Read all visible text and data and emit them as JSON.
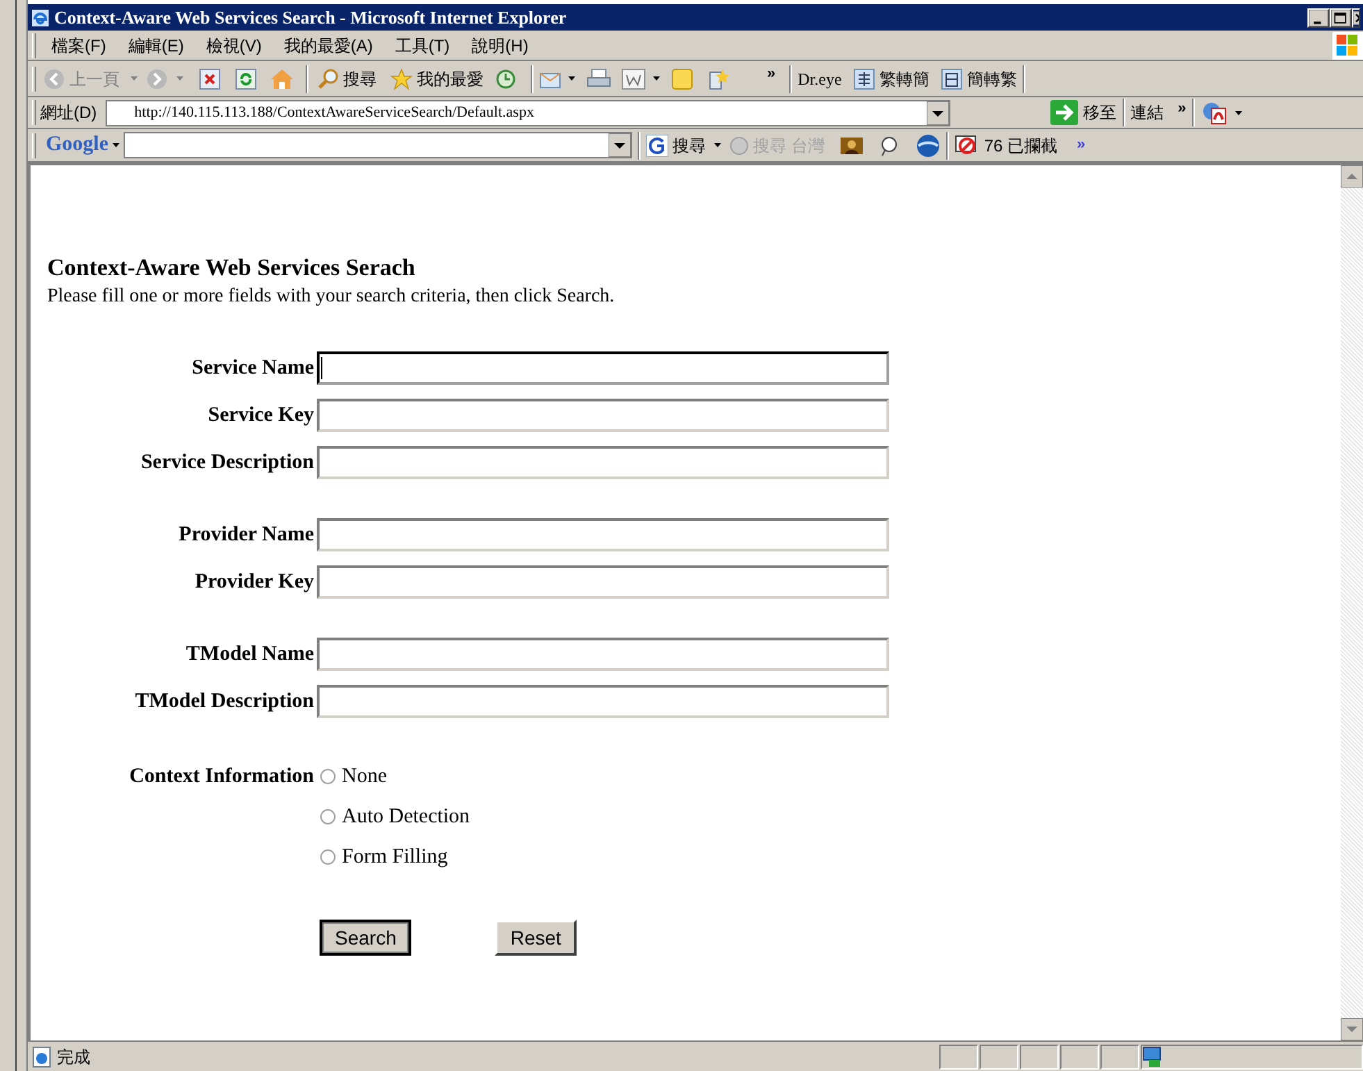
{
  "window": {
    "title": "Context-Aware Web Services Search - Microsoft Internet Explorer"
  },
  "menu": [
    "檔案(F)",
    "編輯(E)",
    "檢視(V)",
    "我的最愛(A)",
    "工具(T)",
    "說明(H)"
  ],
  "toolbar": {
    "back": "上一頁",
    "search": "搜尋",
    "favorites": "我的最愛",
    "more": "»",
    "dreye": "Dr.eye",
    "to_simplified": "繁轉簡",
    "to_traditional": "簡轉繁"
  },
  "address_bar": {
    "label": "網址(D)",
    "url": "http://140.115.113.188/ContextAwareServiceSearch/Default.aspx",
    "go": "移至",
    "links": "連結",
    "more": "»"
  },
  "google_bar": {
    "logo": "Google",
    "search": "搜尋",
    "search_taiwan": "搜尋 台灣",
    "blocked": "76 已攔截",
    "more": "»"
  },
  "page": {
    "heading": "Context-Aware Web Services Serach",
    "instructions": "Please fill one or more fields with your search criteria, then click Search.",
    "field_groups": [
      {
        "fields": [
          {
            "label": "Service Name",
            "focused": true
          },
          {
            "label": "Service Key",
            "focused": false
          },
          {
            "label": "Service Description",
            "focused": false
          }
        ]
      },
      {
        "fields": [
          {
            "label": "Provider Name",
            "focused": false
          },
          {
            "label": "Provider Key",
            "focused": false
          }
        ]
      },
      {
        "fields": [
          {
            "label": "TModel Name",
            "focused": false
          },
          {
            "label": "TModel Description",
            "focused": false
          }
        ]
      }
    ],
    "context": {
      "label": "Context Information",
      "options": [
        {
          "label": "None",
          "selected": false
        },
        {
          "label": "Auto Detection",
          "selected": false
        },
        {
          "label": "Form Filling",
          "selected": false
        }
      ]
    },
    "buttons": [
      {
        "label": "Search",
        "default": true
      },
      {
        "label": "Reset",
        "default": false
      }
    ]
  },
  "status_bar": {
    "text": "完成"
  }
}
